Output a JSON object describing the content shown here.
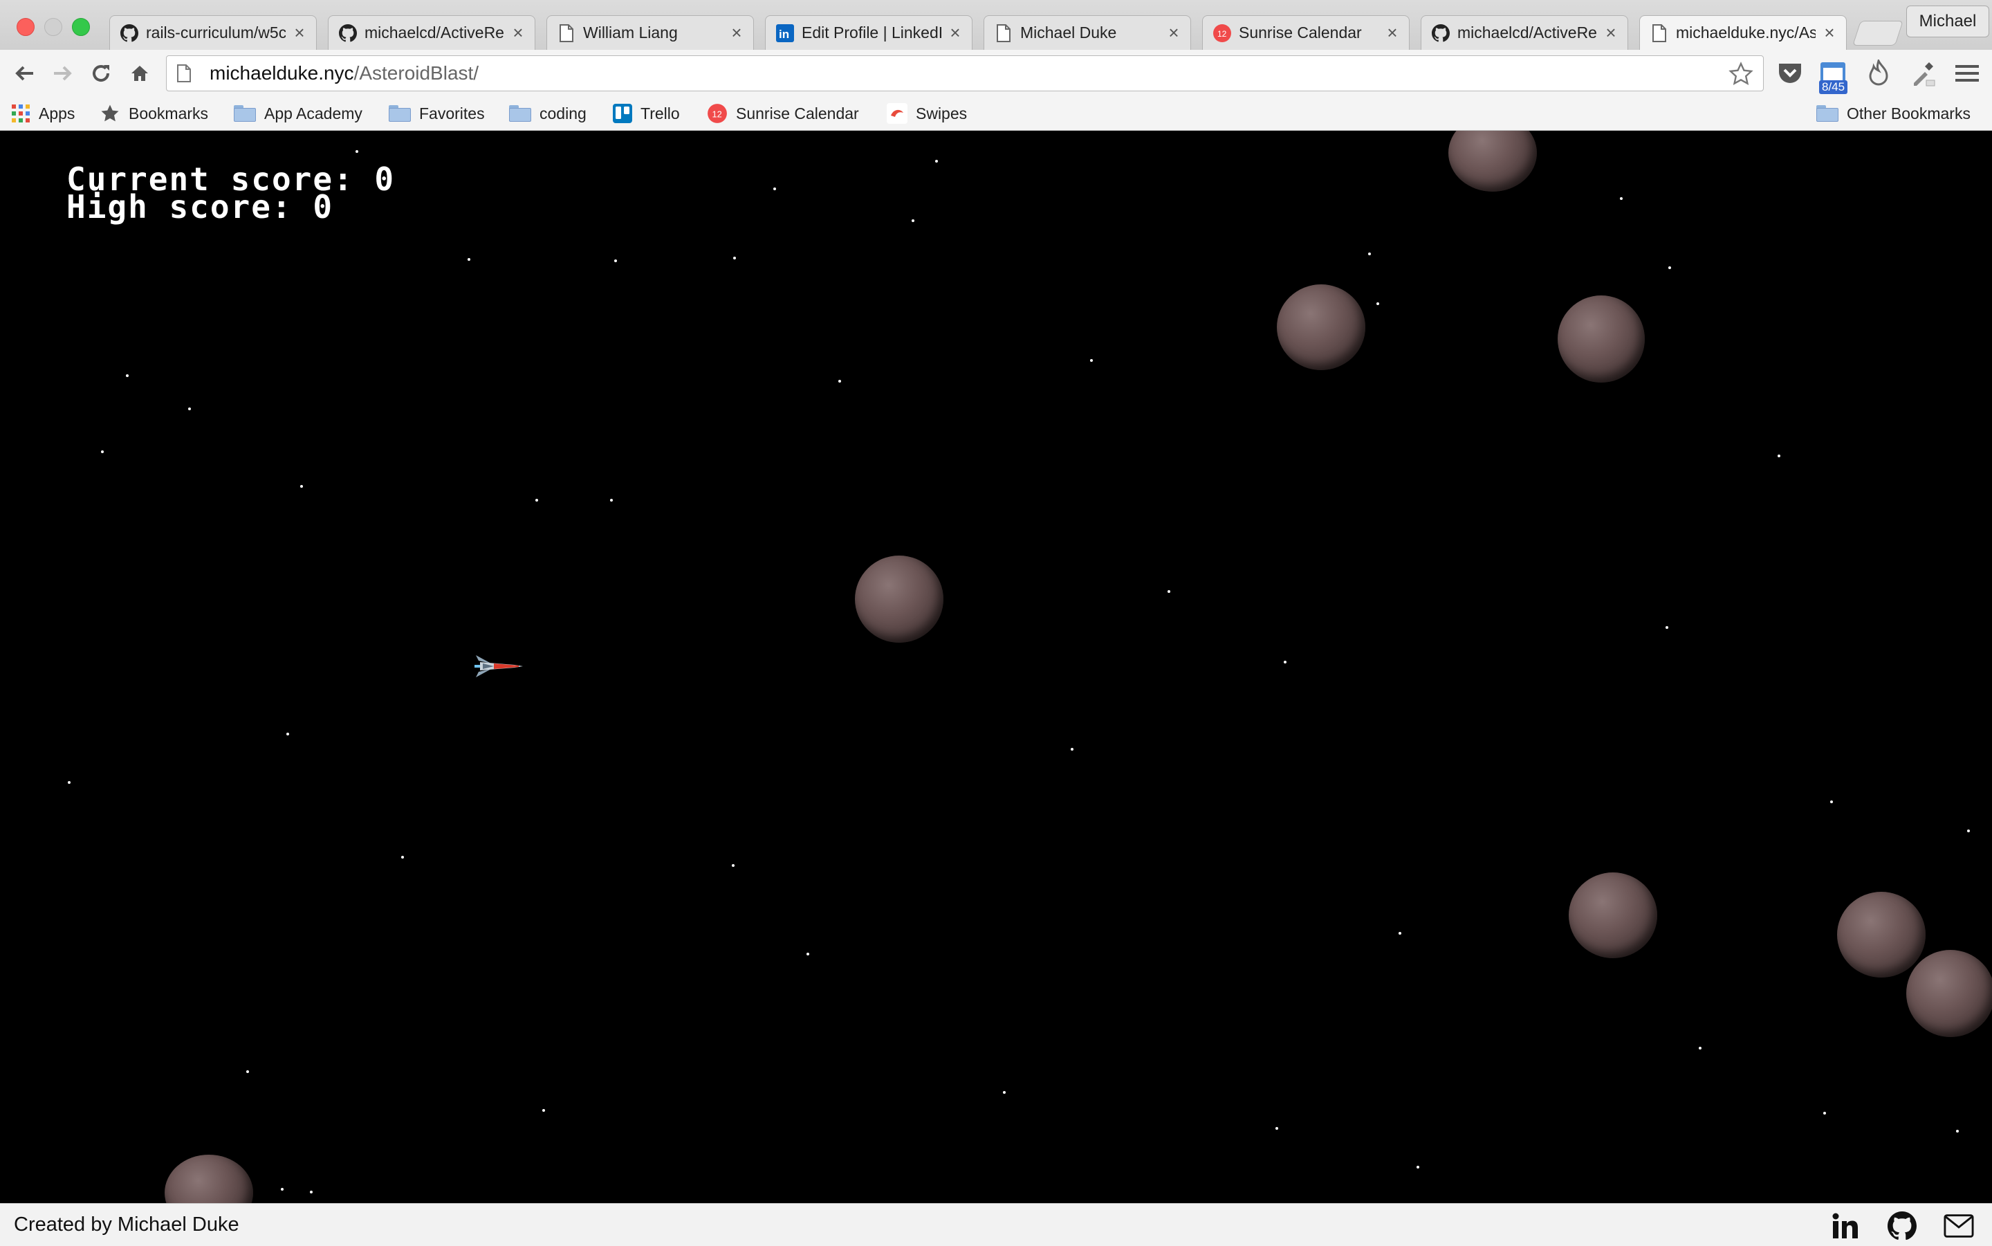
{
  "window": {
    "profile_name": "Michael"
  },
  "tabs": [
    {
      "title": "rails-curriculum/w5c",
      "icon": "github-icon"
    },
    {
      "title": "michaelcd/ActiveRec",
      "icon": "github-icon"
    },
    {
      "title": "William Liang",
      "icon": "page-icon"
    },
    {
      "title": "Edit Profile | LinkedIn",
      "icon": "linkedin-icon"
    },
    {
      "title": "Michael Duke",
      "icon": "page-icon"
    },
    {
      "title": "Sunrise Calendar",
      "icon": "sunrise-icon",
      "badge": "12"
    },
    {
      "title": "michaelcd/ActiveRec",
      "icon": "github-icon"
    },
    {
      "title": "michaelduke.nyc/AsteroidBlast/",
      "icon": "page-icon",
      "active": true
    }
  ],
  "tab_close_glyph": "×",
  "toolbar": {
    "url_host": "michaelduke.nyc",
    "url_path": "/AsteroidBlast/",
    "extension_badge": "8/45"
  },
  "bookmarks": [
    {
      "label": "Apps",
      "icon": "apps-grid-icon"
    },
    {
      "label": "Bookmarks",
      "icon": "star-icon"
    },
    {
      "label": "App Academy",
      "icon": "folder-icon"
    },
    {
      "label": "Favorites",
      "icon": "folder-icon"
    },
    {
      "label": "coding",
      "icon": "folder-icon"
    },
    {
      "label": "Trello",
      "icon": "trello-icon"
    },
    {
      "label": "Sunrise Calendar",
      "icon": "sunrise-icon",
      "badge": "12"
    },
    {
      "label": "Swipes",
      "icon": "swipes-icon"
    }
  ],
  "other_bookmarks": "Other Bookmarks",
  "game": {
    "current_score_text": "Current score: 0",
    "high_score_text": "High score: 0"
  },
  "footer": {
    "credit": "Created by Michael Duke"
  },
  "colors": {
    "background": "#000000",
    "asteroid": "#6c5656",
    "ship_accent": "#d93a2b"
  }
}
